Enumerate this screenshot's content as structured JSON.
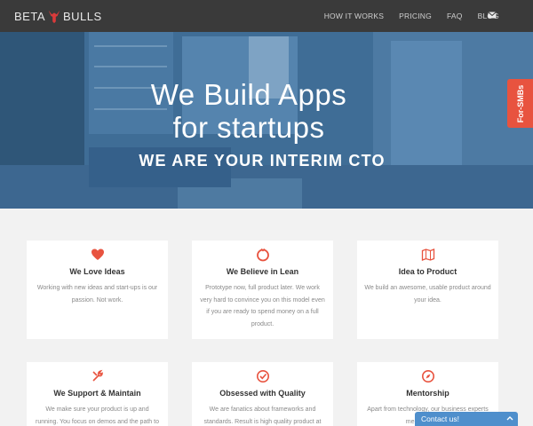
{
  "nav": {
    "logo_left": "BETA",
    "logo_right": "BULLS",
    "links": [
      "HOW IT WORKS",
      "PRICING",
      "FAQ",
      "BLOG"
    ]
  },
  "hero": {
    "title_line1": "We Build Apps",
    "title_line2": "for startups",
    "subtitle": "WE ARE YOUR INTERIM CTO",
    "side_tab": "For-SMBs"
  },
  "cards": [
    {
      "icon": "heart-icon",
      "title": "We Love Ideas",
      "desc": "Working with new ideas and start-ups is our passion. Not work."
    },
    {
      "icon": "lean-circle-icon",
      "title": "We Believe in Lean",
      "desc": "Prototype now, full product later. We work very hard to convince you on this model even if you are ready to spend money on a full product."
    },
    {
      "icon": "map-icon",
      "title": "Idea to Product",
      "desc": "We build an awesome, usable product around your idea."
    },
    {
      "icon": "wrench-icon",
      "title": "We Support & Maintain",
      "desc": "We make sure your product is up and running. You focus on demos and the path to world"
    },
    {
      "icon": "check-circle-icon",
      "title": "Obsessed with Quality",
      "desc": "We are fanatics about frameworks and standards. Result is high quality product at"
    },
    {
      "icon": "compass-icon",
      "title": "Mentorship",
      "desc": "Apart from technology, our business experts mentor you with"
    }
  ],
  "contact": {
    "label": "Contact us!"
  },
  "colors": {
    "accent": "#e8533f",
    "nav_bg": "#3a3a3a",
    "hero_overlay": "#44719a",
    "contact_bg": "#4f8fcc"
  }
}
